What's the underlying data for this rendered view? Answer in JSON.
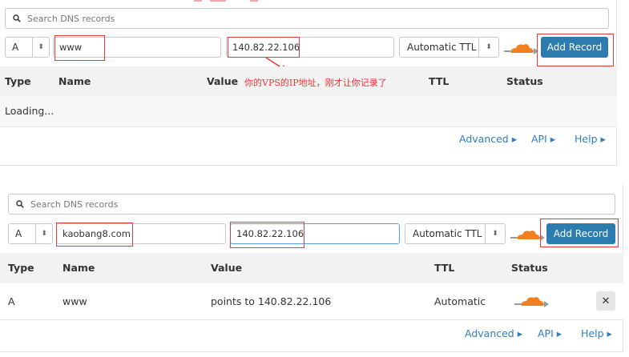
{
  "top": {
    "search_placeholder": "Search DNS records",
    "type_value": "A",
    "name_value": "www",
    "ip_value": "140.82.22.106",
    "ttl_value": "Automatic TTL",
    "add_record_label": "Add Record",
    "annotation": "你的VPS的IP地址，刚才让你记录了",
    "columns": [
      "Type",
      "Name",
      "Value",
      "TTL",
      "Status"
    ],
    "loading_text": "Loading...",
    "links": [
      "Advanced ▸",
      "API ▸",
      "Help ▸"
    ]
  },
  "bottom": {
    "search_placeholder": "Search DNS records",
    "type_value": "A",
    "name_value": "kaobang8.com",
    "ip_value": "140.82.22.106",
    "ttl_value": "Automatic TTL",
    "add_record_label": "Add Record",
    "columns": [
      "Type",
      "Name",
      "Value",
      "TTL",
      "Status"
    ],
    "record": {
      "type": "A",
      "name": "www",
      "value": "points to 140.82.22.106",
      "ttl": "Automatic",
      "delete_label": "✕"
    },
    "links": [
      "Advanced ▸",
      "API ▸",
      "Help ▸"
    ]
  },
  "colors": {
    "accent_button": "#2c7cb0",
    "cloud_orange": "#f38020",
    "annotation_red": "#e23b3b",
    "link_blue": "#2f7dbf"
  },
  "icons": [
    "search-icon",
    "cloud-proxy-icon",
    "updown-arrow-icon",
    "close-icon"
  ]
}
